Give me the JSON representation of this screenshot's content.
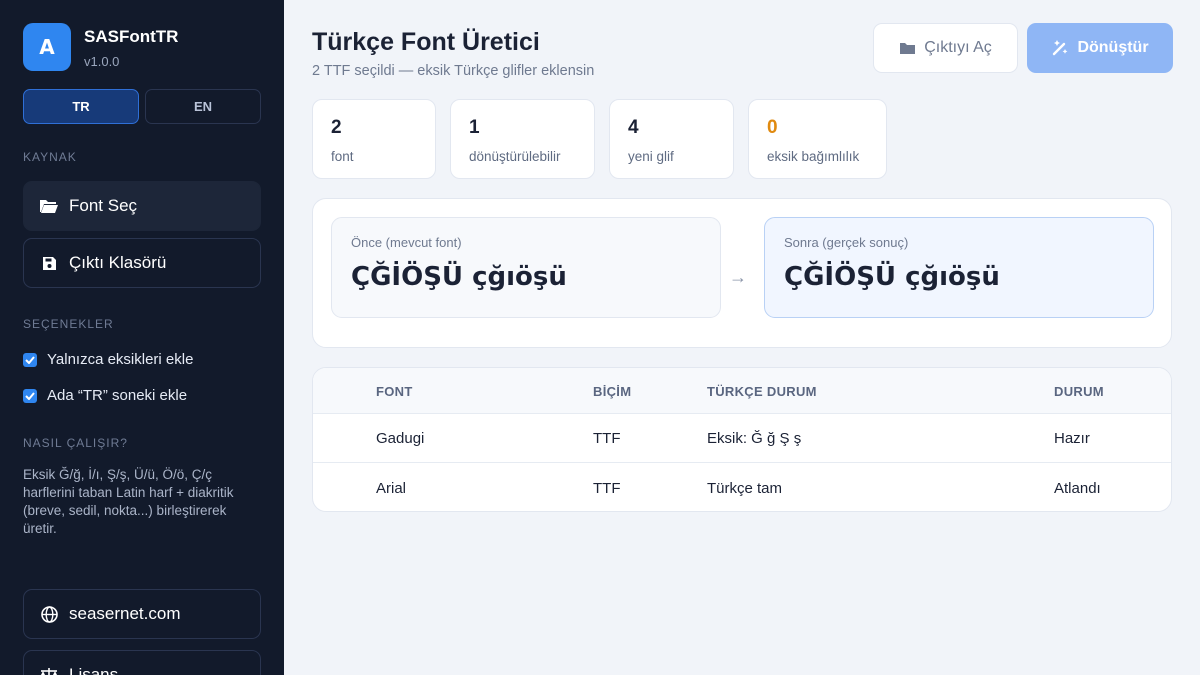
{
  "app": {
    "name": "SASFontTR",
    "version": "v1.0.0",
    "logo_letter": "A",
    "accent_color": "#2f86f0"
  },
  "languages": [
    {
      "code": "TR",
      "active": true
    },
    {
      "code": "EN",
      "active": false
    }
  ],
  "sidebar": {
    "source_label": "KAYNAK",
    "font_select": "Font Seç",
    "output_folder": "Çıktı Klasörü",
    "options_label": "SEÇENEKLER",
    "options": [
      {
        "label": "Yalnızca eksikleri ekle",
        "checked": true
      },
      {
        "label": "Ada “TR” soneki ekle",
        "checked": true
      }
    ],
    "howto_label": "NASIL ÇALIŞIR?",
    "howto_text": "Eksik Ğ/ğ, İ/ı, Ş/ş, Ü/ü, Ö/ö, Ç/ç harflerini taban Latin harf + diakritik (breve, sedil, nokta...) birleştirerek üretir.",
    "website": "seasernet.com",
    "license": "Lisans"
  },
  "header": {
    "title": "Türkçe Font Üretici",
    "subtitle": "2 TTF seçildi — eksik Türkçe glifler eklensin",
    "open_output": "Çıktıyı Aç",
    "convert": "Dönüştür"
  },
  "stats": [
    {
      "value": "2",
      "label": "font"
    },
    {
      "value": "1",
      "label": "dönüştürülebilir"
    },
    {
      "value": "4",
      "label": "yeni glif"
    },
    {
      "value": "0",
      "label": "eksik bağımlılık"
    }
  ],
  "preview": {
    "before_label": "Önce (mevcut font)",
    "after_label": "Sonra (gerçek sonuç)",
    "sample": "ÇĞİÖŞÜ çğıöşü",
    "arrow": "→"
  },
  "table": {
    "headers": [
      "FONT",
      "BİÇİM",
      "TÜRKÇE DURUM",
      "DURUM"
    ],
    "rows": [
      [
        "Gadugi",
        "TTF",
        "Eksik: Ğ ğ Ş ş",
        "Hazır"
      ],
      [
        "Arial",
        "TTF",
        "Türkçe tam",
        "Atlandı"
      ]
    ]
  }
}
